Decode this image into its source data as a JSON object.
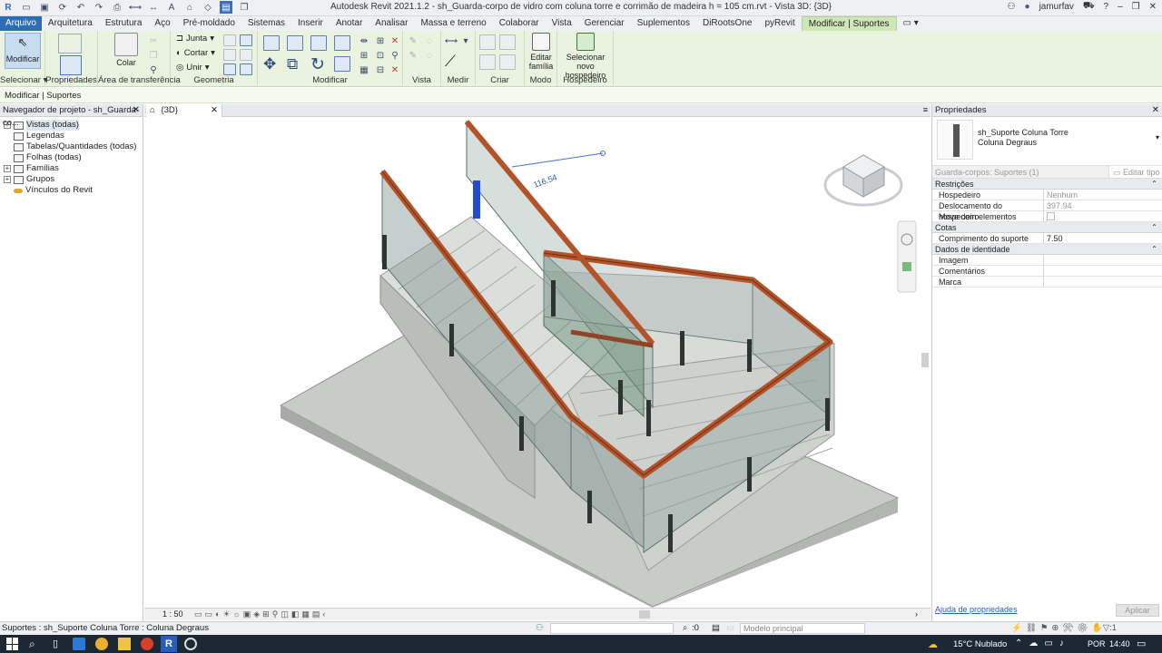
{
  "title_bar": {
    "title": "Autodesk Revit 2021.1.2 - sh_Guarda-corpo de vidro com coluna torre e corrimão de madeira h = 105 cm.rvt - Vista 3D: {3D}",
    "user": "jamurfav"
  },
  "menu_tabs": [
    "Arquivo",
    "Arquitetura",
    "Estrutura",
    "Aço",
    "Pré-moldado",
    "Sistemas",
    "Inserir",
    "Anotar",
    "Analisar",
    "Massa e terreno",
    "Colaborar",
    "Vista",
    "Gerenciar",
    "Suplementos",
    "DiRootsOne",
    "pyRevit",
    "Modificar | Suportes"
  ],
  "ribbon": {
    "modify_label": "Modificar",
    "select_panel": "Selecionar",
    "properties_panel": "Propriedades",
    "clipboard_panel": "Área de transferência",
    "paste_label": "Colar",
    "geometry_panel": "Geometria",
    "join_label": "Junta",
    "cut_label": "Cortar",
    "unite_label": "Unir",
    "modify_panel": "Modificar",
    "view_panel": "Vista",
    "measure_panel": "Medir",
    "create_panel": "Criar",
    "mode_panel": "Modo",
    "edit_family_line1": "Editar",
    "edit_family_line2": "família",
    "new_host_line1": "Selecionar",
    "new_host_line2": "novo hospedeiro",
    "host_panel": "Hospedeiro"
  },
  "context_bar": "Modificar | Suportes",
  "project_browser": {
    "title": "Navegador de projeto - sh_Guarda-co...",
    "items": [
      "Vistas (todas)",
      "Legendas",
      "Tabelas/Quantidades (todas)",
      "Folhas (todas)",
      "Famílias",
      "Grupos",
      "Vínculos do Revit"
    ]
  },
  "view": {
    "tab_label": "{3D}",
    "dimension": "116.54",
    "scale": "1 : 50"
  },
  "properties": {
    "title": "Propriedades",
    "family_line1": "sh_Suporte Coluna Torre",
    "family_line2": "Coluna Degraus",
    "type_selector": "Guarda-corpos: Suportes (1)",
    "edit_type": "Editar tipo",
    "groups": [
      {
        "name": "Restrições",
        "rows": [
          {
            "k": "Hospedeiro",
            "v": "Nenhum"
          },
          {
            "k": "Deslocamento do hospedeiro",
            "v": "397.94"
          },
          {
            "k": "Move com elementos próximos",
            "v": ""
          }
        ]
      },
      {
        "name": "Cotas",
        "rows": [
          {
            "k": "Comprimento do suporte",
            "v": "7.50"
          }
        ]
      },
      {
        "name": "Dados de identidade",
        "rows": [
          {
            "k": "Imagem",
            "v": ""
          },
          {
            "k": "Comentários",
            "v": ""
          },
          {
            "k": "Marca",
            "v": ""
          }
        ]
      }
    ],
    "help_link": "Ajuda de propriedades",
    "apply": "Aplicar"
  },
  "status_bar": {
    "text": "Suportes : sh_Suporte Coluna Torre : Coluna Degraus",
    "workset_value": ":0",
    "design_option": "Modelo principal"
  },
  "taskbar": {
    "weather": "15°C  Nublado",
    "lang": "POR",
    "time": "14:40"
  },
  "colors": {
    "file_tab": "#2d6db6",
    "context_tab": "#cfe6b8",
    "handrail": "#b3532a",
    "glass": "#7f9590",
    "concrete": "#c6c8c6",
    "selected_support": "#1f4fd0"
  }
}
